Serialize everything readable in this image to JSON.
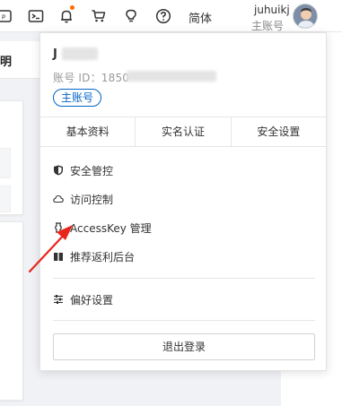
{
  "topbar": {
    "icons": [
      "console-icon",
      "terminal-icon",
      "bell-icon",
      "cart-icon",
      "lightbulb-icon",
      "help-icon"
    ],
    "notice_dot_color": "#ff6a00",
    "lang_label": "简体",
    "user_name": "juhuikj",
    "user_role": "主账号"
  },
  "background": {
    "tab_label": "明"
  },
  "dropdown": {
    "name": "J",
    "account_id_prefix": "账号 ID：1850",
    "badge": "主账号",
    "accent_color": "#0064c8",
    "tabs": [
      {
        "label": "基本资料"
      },
      {
        "label": "实名认证"
      },
      {
        "label": "安全设置"
      }
    ],
    "menu": [
      {
        "label": "安全管控",
        "icon": "shield-icon"
      },
      {
        "label": "访问控制",
        "icon": "cloud-icon"
      },
      {
        "label": "AccessKey 管理",
        "icon": "key-icon"
      },
      {
        "label": "推荐返利后台",
        "icon": "gift-icon"
      },
      {
        "label": "偏好设置",
        "icon": "sliders-icon"
      }
    ],
    "logout_label": "退出登录"
  },
  "annotation": {
    "arrow_color": "#e8251c"
  }
}
